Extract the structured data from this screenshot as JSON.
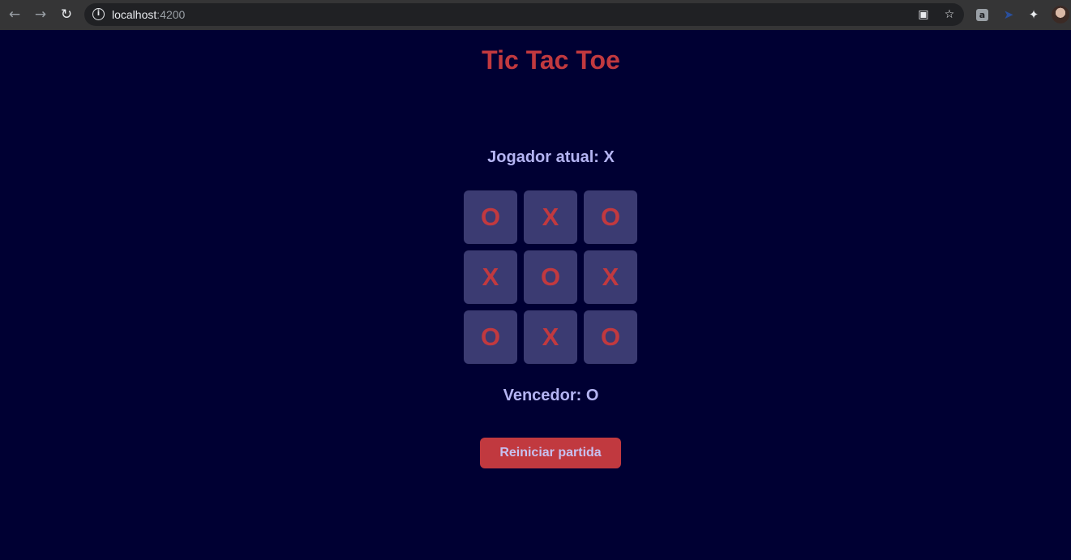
{
  "browser": {
    "url_host": "localhost",
    "url_port": ":4200"
  },
  "game": {
    "title": "Tic Tac Toe",
    "current_player_text": "Jogador atual: X",
    "board": [
      "O",
      "X",
      "O",
      "X",
      "O",
      "X",
      "O",
      "X",
      "O"
    ],
    "winner_text": "Vencedor: O",
    "restart_label": "Reiniciar partida"
  },
  "colors": {
    "background": "#000033",
    "accent_red": "#c1393f",
    "cell_bg": "#3b3b72",
    "text_lavender": "#b4b4f2"
  }
}
